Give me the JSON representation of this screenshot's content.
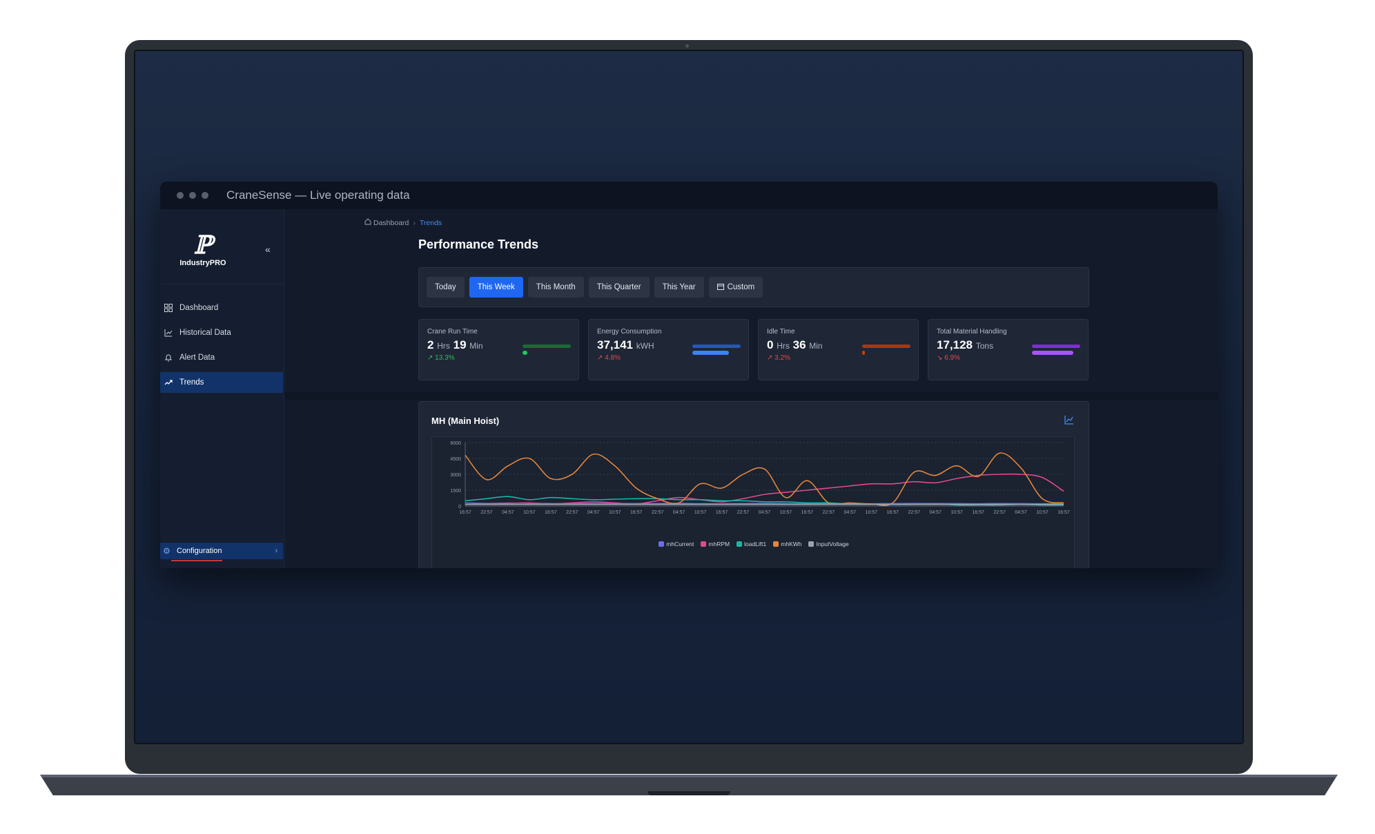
{
  "window": {
    "title": "CraneSense — Live operating data"
  },
  "sidebar": {
    "logo_text": "IndustryPRO",
    "items": [
      {
        "label": "Dashboard",
        "icon": "grid-icon",
        "active": false
      },
      {
        "label": "Historical Data",
        "icon": "chart-line-icon",
        "active": false
      },
      {
        "label": "Alert Data",
        "icon": "bell-icon",
        "active": false
      },
      {
        "label": "Trends",
        "icon": "trend-up-icon",
        "active": true
      }
    ],
    "config_label": "Configuration"
  },
  "breadcrumb": {
    "home": "Dashboard",
    "current": "Trends"
  },
  "page": {
    "title": "Performance Trends"
  },
  "filters": {
    "options": [
      "Today",
      "This Week",
      "This Month",
      "This Quarter",
      "This Year",
      "Custom"
    ],
    "selected": "This Week"
  },
  "stats": [
    {
      "label": "Crane Run Time",
      "v1": "2",
      "u1": "Hrs",
      "v2": "19",
      "u2": "Min",
      "change": "↗ 13.3%",
      "change_color": "#2fbf58",
      "bar_color": "#22c55e",
      "track_color": "#1a6b34",
      "fill_fraction": 0.1
    },
    {
      "label": "Energy Consumption",
      "v1": "37,141",
      "u1": "kWH",
      "v2": "",
      "u2": "",
      "change": "↗ 4.8%",
      "change_color": "#e24848",
      "bar_color": "#3b82f6",
      "track_color": "#2856b5",
      "fill_fraction": 0.75
    },
    {
      "label": "Idle Time",
      "v1": "0",
      "u1": "Hrs",
      "v2": "36",
      "u2": "Min",
      "change": "↗ 3.2%",
      "change_color": "#e24848",
      "bar_color": "#c2410c",
      "track_color": "#a8390d",
      "fill_fraction": 0.02
    },
    {
      "label": "Total Material Handling",
      "v1": "17,128",
      "u1": "Tons",
      "v2": "",
      "u2": "",
      "change": "↘ 6.9%",
      "change_color": "#e24848",
      "bar_color": "#a855f7",
      "track_color": "#7b2fd0",
      "fill_fraction": 0.85
    }
  ],
  "chart": {
    "title": "MH (Main Hoist)"
  },
  "chart_data": {
    "type": "line",
    "y_ticks": [
      "6000",
      "4500",
      "3000",
      "1500",
      "0"
    ],
    "ylim": [
      0,
      6000
    ],
    "x": [
      "16:57",
      "22:57",
      "04:57",
      "10:57",
      "16:57",
      "22:57",
      "04:57",
      "10:57",
      "16:57",
      "22:57",
      "04:57",
      "10:57",
      "16:57",
      "22:57",
      "04:57",
      "10:57",
      "16:57",
      "22:57",
      "04:57",
      "10:57",
      "16:57",
      "22:57",
      "04:57",
      "10:57",
      "16:57",
      "22:57",
      "04:57",
      "10:57",
      "16:57"
    ],
    "series": [
      {
        "name": "mhCurrent",
        "color": "#6b6ee8",
        "values": [
          300,
          250,
          280,
          260,
          240,
          220,
          260,
          250,
          230,
          240,
          260,
          230,
          220,
          240,
          250,
          230,
          220,
          240,
          230,
          220,
          230,
          250,
          240,
          230,
          220,
          240,
          230,
          220,
          240
        ]
      },
      {
        "name": "mhRPM",
        "color": "#e0498f",
        "values": [
          150,
          200,
          250,
          300,
          200,
          300,
          400,
          300,
          200,
          500,
          800,
          600,
          400,
          700,
          1100,
          1300,
          1500,
          1700,
          1900,
          2100,
          2100,
          2300,
          2200,
          2600,
          2900,
          3000,
          3000,
          2700,
          1400
        ]
      },
      {
        "name": "loadLift1",
        "color": "#14b8a6",
        "values": [
          500,
          700,
          900,
          600,
          800,
          700,
          600,
          650,
          700,
          700,
          600,
          600,
          500,
          500,
          400,
          400,
          300,
          300,
          200,
          200,
          150,
          150,
          200,
          100,
          100,
          100,
          150,
          100,
          100
        ]
      },
      {
        "name": "mhKWh",
        "color": "#e3853a",
        "values": [
          4800,
          2500,
          3800,
          4500,
          2600,
          3000,
          4900,
          3800,
          1700,
          700,
          300,
          2100,
          1700,
          3000,
          3500,
          800,
          2400,
          300,
          300,
          200,
          300,
          3200,
          2900,
          3800,
          2800,
          5000,
          3600,
          700,
          300
        ]
      },
      {
        "name": "InputVoltage",
        "color": "#9ca3af",
        "values": [
          150,
          150,
          150,
          150,
          150,
          150,
          150,
          150,
          150,
          150,
          150,
          150,
          150,
          150,
          150,
          150,
          150,
          150,
          150,
          150,
          150,
          150,
          150,
          150,
          150,
          150,
          150,
          150,
          150
        ]
      }
    ]
  }
}
